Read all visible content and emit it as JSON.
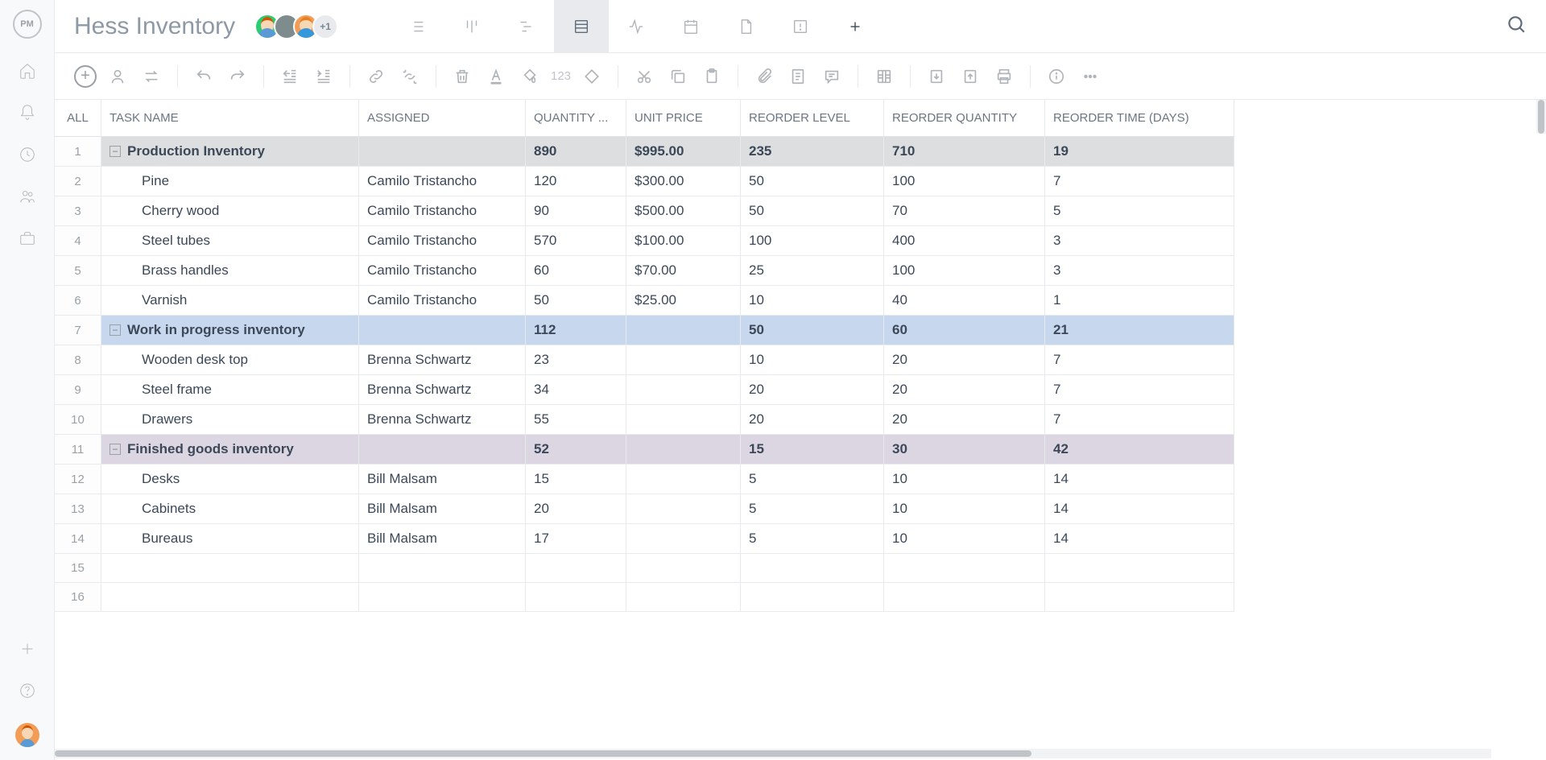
{
  "page_title": "Hess Inventory",
  "avatar_more": "+1",
  "columns": {
    "all": "ALL",
    "task_name": "TASK NAME",
    "assigned": "ASSIGNED",
    "quantity": "QUANTITY ...",
    "unit_price": "UNIT PRICE",
    "reorder_level": "REORDER LEVEL",
    "reorder_qty": "REORDER QUANTITY",
    "reorder_time": "REORDER TIME (DAYS)"
  },
  "toolbar_text": "123",
  "collapse_glyph": "−",
  "logo_text": "PM",
  "rows": [
    {
      "num": "1",
      "type": "group",
      "color": "gray",
      "task": "Production Inventory",
      "assigned": "",
      "qty": "890",
      "price": "$995.00",
      "rlevel": "235",
      "rqty": "710",
      "rtime": "19"
    },
    {
      "num": "2",
      "type": "item",
      "task": "Pine",
      "assigned": "Camilo Tristancho",
      "qty": "120",
      "price": "$300.00",
      "rlevel": "50",
      "rqty": "100",
      "rtime": "7"
    },
    {
      "num": "3",
      "type": "item",
      "task": "Cherry wood",
      "assigned": "Camilo Tristancho",
      "qty": "90",
      "price": "$500.00",
      "rlevel": "50",
      "rqty": "70",
      "rtime": "5"
    },
    {
      "num": "4",
      "type": "item",
      "task": "Steel tubes",
      "assigned": "Camilo Tristancho",
      "qty": "570",
      "price": "$100.00",
      "rlevel": "100",
      "rqty": "400",
      "rtime": "3"
    },
    {
      "num": "5",
      "type": "item",
      "task": "Brass handles",
      "assigned": "Camilo Tristancho",
      "qty": "60",
      "price": "$70.00",
      "rlevel": "25",
      "rqty": "100",
      "rtime": "3"
    },
    {
      "num": "6",
      "type": "item",
      "task": "Varnish",
      "assigned": "Camilo Tristancho",
      "qty": "50",
      "price": "$25.00",
      "rlevel": "10",
      "rqty": "40",
      "rtime": "1"
    },
    {
      "num": "7",
      "type": "group",
      "color": "blue",
      "task": "Work in progress inventory",
      "assigned": "",
      "qty": "112",
      "price": "",
      "rlevel": "50",
      "rqty": "60",
      "rtime": "21"
    },
    {
      "num": "8",
      "type": "item",
      "task": "Wooden desk top",
      "assigned": "Brenna Schwartz",
      "qty": "23",
      "price": "",
      "rlevel": "10",
      "rqty": "20",
      "rtime": "7"
    },
    {
      "num": "9",
      "type": "item",
      "task": "Steel frame",
      "assigned": "Brenna Schwartz",
      "qty": "34",
      "price": "",
      "rlevel": "20",
      "rqty": "20",
      "rtime": "7"
    },
    {
      "num": "10",
      "type": "item",
      "task": "Drawers",
      "assigned": "Brenna Schwartz",
      "qty": "55",
      "price": "",
      "rlevel": "20",
      "rqty": "20",
      "rtime": "7"
    },
    {
      "num": "11",
      "type": "group",
      "color": "purple",
      "task": "Finished goods inventory",
      "assigned": "",
      "qty": "52",
      "price": "",
      "rlevel": "15",
      "rqty": "30",
      "rtime": "42"
    },
    {
      "num": "12",
      "type": "item",
      "task": "Desks",
      "assigned": "Bill Malsam",
      "qty": "15",
      "price": "",
      "rlevel": "5",
      "rqty": "10",
      "rtime": "14"
    },
    {
      "num": "13",
      "type": "item",
      "task": "Cabinets",
      "assigned": "Bill Malsam",
      "qty": "20",
      "price": "",
      "rlevel": "5",
      "rqty": "10",
      "rtime": "14"
    },
    {
      "num": "14",
      "type": "item",
      "task": "Bureaus",
      "assigned": "Bill Malsam",
      "qty": "17",
      "price": "",
      "rlevel": "5",
      "rqty": "10",
      "rtime": "14"
    },
    {
      "num": "15",
      "type": "empty"
    },
    {
      "num": "16",
      "type": "empty"
    }
  ]
}
